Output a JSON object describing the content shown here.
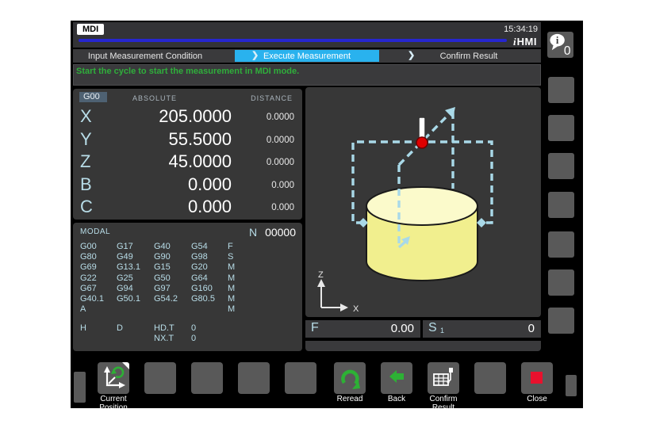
{
  "header": {
    "mode": "MDI",
    "time": "15:34:19",
    "logo": {
      "i": "i",
      "hmi": "HMI"
    }
  },
  "steps": [
    {
      "label": "Input Measurement Condition",
      "active": false
    },
    {
      "label": "Execute Measurement",
      "active": true
    },
    {
      "label": "Confirm Result",
      "active": false
    }
  ],
  "step_separator": "❯",
  "message": "Start the cycle to start the measurement in MDI mode.",
  "position": {
    "gcode_badge": "G00",
    "col_absolute": "ABSOLUTE",
    "col_distance": "DISTANCE",
    "axes": [
      {
        "name": "X",
        "absolute": "205.0000",
        "distance": "0.0000"
      },
      {
        "name": "Y",
        "absolute": "55.5000",
        "distance": "0.0000"
      },
      {
        "name": "Z",
        "absolute": "45.0000",
        "distance": "0.0000"
      },
      {
        "name": "B",
        "absolute": "0.000",
        "distance": "0.000"
      },
      {
        "name": "C",
        "absolute": "0.000",
        "distance": "0.000"
      }
    ]
  },
  "modal": {
    "title": "MODAL",
    "n_label": "N",
    "n_value": "00000",
    "rows": [
      [
        "G00",
        "G17",
        "G40",
        "G54",
        "F"
      ],
      [
        "G80",
        "G49",
        "G90",
        "G98",
        "S"
      ],
      [
        "G69",
        "G13.1",
        "G15",
        "G20",
        "M"
      ],
      [
        "G22",
        "G25",
        "G50",
        "G64",
        "M"
      ],
      [
        "G67",
        "G94",
        "G97",
        "G160",
        "M"
      ],
      [
        "G40.1",
        "G50.1",
        "G54.2",
        "G80.5",
        "M"
      ],
      [
        "A",
        "",
        "",
        "",
        "M"
      ]
    ],
    "tool_rows": [
      [
        "H",
        "D",
        "HD.T",
        "0"
      ],
      [
        "",
        "",
        "NX.T",
        "0"
      ]
    ]
  },
  "graphic": {
    "axis_vertical": "Z",
    "axis_horizontal": "X"
  },
  "feed": {
    "label": "F",
    "value": "0.00"
  },
  "spindle": {
    "label": "S",
    "index": "1",
    "value": "0"
  },
  "toolbar": [
    {
      "label": "Current Position"
    },
    {
      "label": ""
    },
    {
      "label": ""
    },
    {
      "label": ""
    },
    {
      "label": ""
    },
    {
      "label": "Reread"
    },
    {
      "label": "Back"
    },
    {
      "label": "Confirm Result"
    },
    {
      "label": ""
    },
    {
      "label": "Close"
    }
  ],
  "sidebar": {
    "info_count": "0"
  },
  "colors": {
    "active_step": "#29b2ee",
    "progress_bar": "#2626cf",
    "message_green": "#2fae3b",
    "cnc_cyan": "#b8dde8",
    "path_blue": "#a9d9e8",
    "workpiece_yellow": "#f1ef8e",
    "probe_red": "#e00000",
    "close_red": "#e8112d",
    "button_gray": "#595959"
  }
}
